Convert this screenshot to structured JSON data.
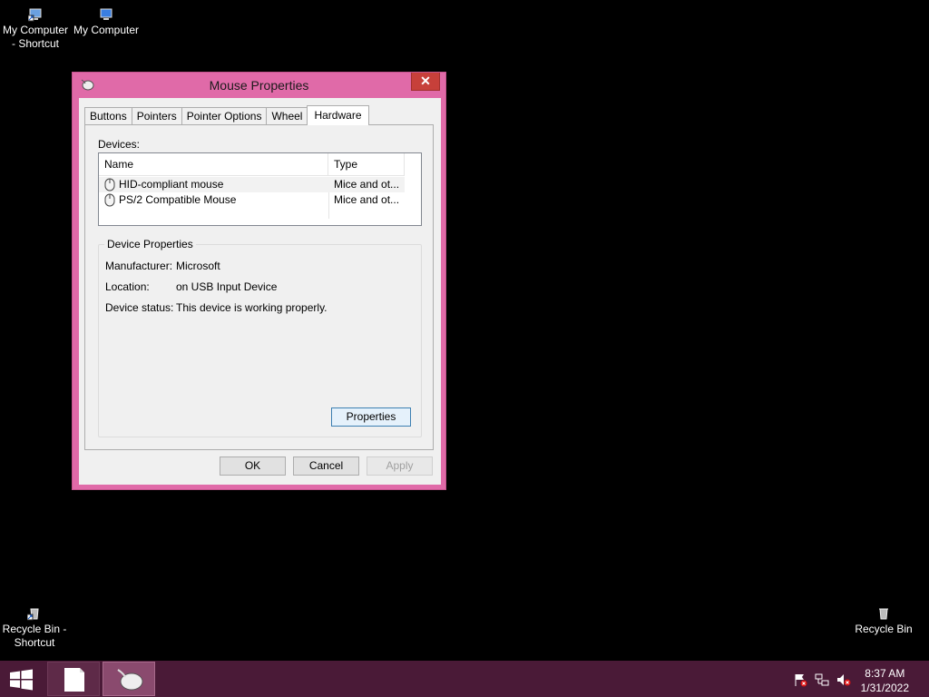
{
  "desktop": {
    "icons": [
      {
        "label_line1": "My Computer",
        "label_line2": "- Shortcut",
        "icon": "computer-shortcut-icon"
      },
      {
        "label_line1": "My Computer",
        "label_line2": "",
        "icon": "computer-icon"
      },
      {
        "label_line1": "Recycle Bin -",
        "label_line2": "Shortcut",
        "icon": "recycle-bin-shortcut-icon"
      },
      {
        "label_line1": "Recycle Bin",
        "label_line2": "",
        "icon": "recycle-bin-icon"
      }
    ]
  },
  "dialog": {
    "title": "Mouse Properties",
    "close_symbol": "✕",
    "tabs": [
      {
        "label": "Buttons",
        "active": false
      },
      {
        "label": "Pointers",
        "active": false
      },
      {
        "label": "Pointer Options",
        "active": false
      },
      {
        "label": "Wheel",
        "active": false
      },
      {
        "label": "Hardware",
        "active": true
      }
    ],
    "devices_label": "Devices:",
    "columns": {
      "name": "Name",
      "type": "Type"
    },
    "devices": [
      {
        "name": "HID-compliant mouse",
        "type": "Mice and ot...",
        "selected": true
      },
      {
        "name": "PS/2 Compatible Mouse",
        "type": "Mice and ot...",
        "selected": false
      }
    ],
    "device_properties": {
      "title": "Device Properties",
      "manufacturer_label": "Manufacturer:",
      "manufacturer_value": "Microsoft",
      "location_label": "Location:",
      "location_value": "on USB Input Device",
      "status_label": "Device status:",
      "status_value": "This device is working properly.",
      "properties_button": "Properties"
    },
    "buttons": {
      "ok": "OK",
      "cancel": "Cancel",
      "apply": "Apply"
    }
  },
  "taskbar": {
    "clock_time": "8:37 AM",
    "clock_date": "1/31/2022"
  },
  "colors": {
    "window_frame": "#e06aa8",
    "taskbar": "#4a1a37",
    "close_button": "#c7403a"
  }
}
